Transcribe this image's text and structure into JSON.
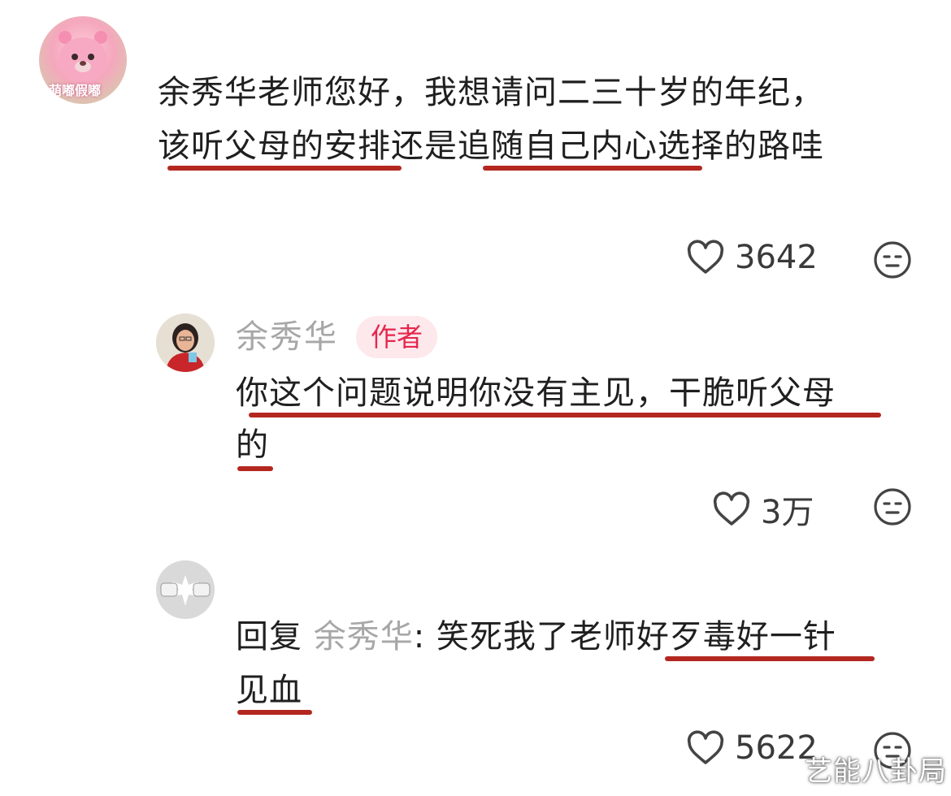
{
  "comment1": {
    "avatar_label": "萌嘟假嘟",
    "line1": "余秀华老师您好，我想请问二三十岁的年纪，",
    "line2": "该听父母的安排还是追随自己内心选择的路哇",
    "likes": "3642",
    "icons": {
      "like": "heart-outline-icon",
      "dislike": "neutral-face-icon"
    }
  },
  "reply1": {
    "author": "余秀华",
    "badge": "作者",
    "line1": "你这个问题说明你没有主见，干脆听父母",
    "line2": "的",
    "likes": "3万"
  },
  "reply2": {
    "prefix": "回复",
    "mention": "余秀华",
    "sep": ":",
    "line1_rest": "笑死我了老师好歹毒好一针",
    "line2": "见血",
    "likes": "5622"
  },
  "watermark": "艺能八卦局",
  "colors": {
    "underline": "#b3271f",
    "badge_bg": "#fde8ec",
    "badge_text": "#e5264d"
  }
}
